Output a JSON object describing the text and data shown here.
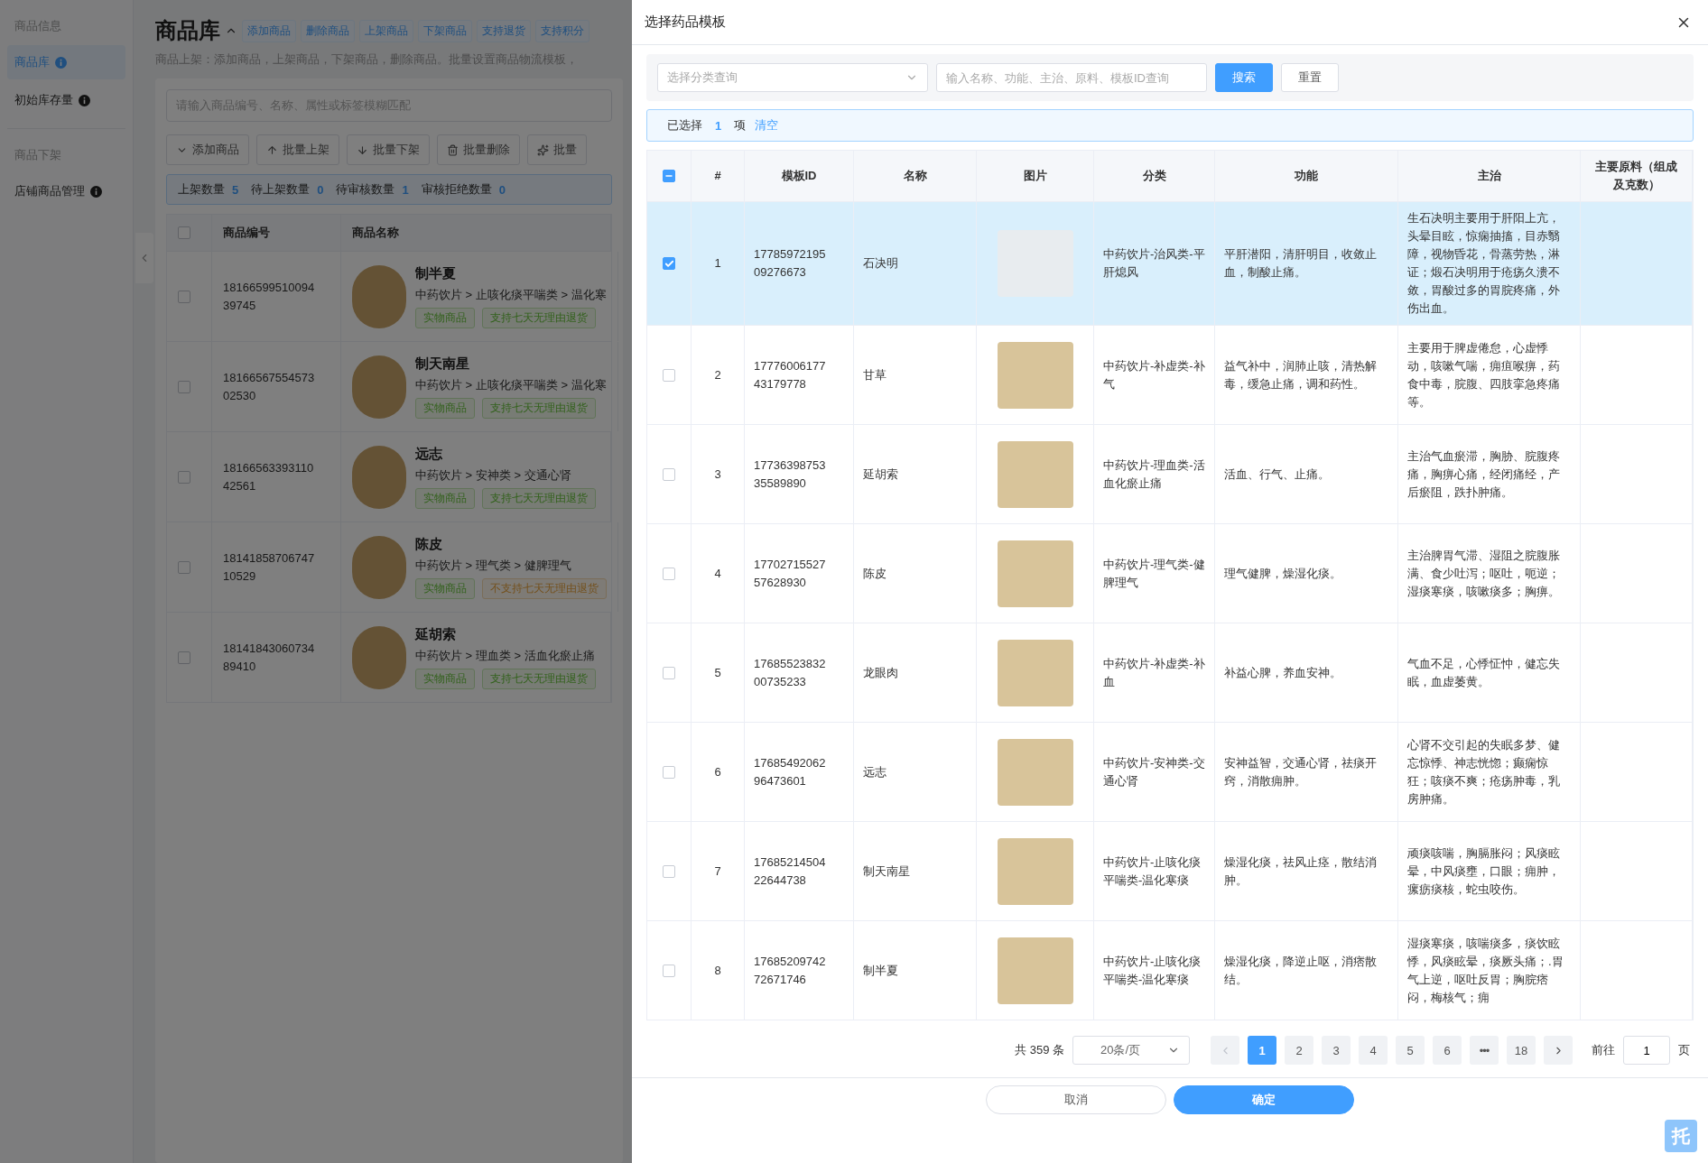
{
  "background_page": {
    "sidebar": [
      {
        "kind": "group",
        "label": "商品信息"
      },
      {
        "kind": "item",
        "label": "商品库",
        "selected": true,
        "info": true
      },
      {
        "kind": "item",
        "label": "初始库存量",
        "selected": false,
        "info": true
      },
      {
        "kind": "divider"
      },
      {
        "kind": "group",
        "label": "商品下架"
      },
      {
        "kind": "item",
        "label": "店铺商品管理",
        "selected": false,
        "info": true
      }
    ],
    "title": "商品库",
    "title_tags": [
      "添加商品",
      "删除商品",
      "上架商品",
      "下架商品",
      "支持退货",
      "支持积分"
    ],
    "subtitle": "商品上架：添加商品，上架商品，下架商品，删除商品。批量设置商品物流模板，",
    "search": {
      "placeholder": "请输入商品编号、名称、属性或标签模糊匹配"
    },
    "toolbar": [
      {
        "kind": "down",
        "label": "添加商品"
      },
      {
        "kind": "up",
        "label": "批量上架"
      },
      {
        "kind": "arrow_down",
        "label": "批量下架"
      },
      {
        "kind": "trash",
        "label": "批量删除"
      },
      {
        "kind": "spark",
        "label": "批量"
      }
    ],
    "stats": [
      {
        "label": "上架数量",
        "value": "5"
      },
      {
        "label": "待上架数量",
        "value": "0"
      },
      {
        "label": "待审核数量",
        "value": "1"
      },
      {
        "label": "审核拒绝数量",
        "value": "0"
      }
    ],
    "table": {
      "header_checked": false,
      "columns": [
        "商品编号",
        "商品名称"
      ],
      "rows": [
        {
          "checked": false,
          "id": "1816659951009439745",
          "name": "制半夏",
          "category": "中药饮片 > 止咳化痰平喘类 > 温化寒",
          "tags": [
            {
              "kind": "success",
              "label": "实物商品"
            },
            {
              "kind": "success",
              "label": "支持七天无理由退货"
            }
          ]
        },
        {
          "checked": false,
          "id": "1816656755457302530",
          "name": "制天南星",
          "category": "中药饮片 > 止咳化痰平喘类 > 温化寒",
          "tags": [
            {
              "kind": "success",
              "label": "实物商品"
            },
            {
              "kind": "success",
              "label": "支持七天无理由退货"
            }
          ]
        },
        {
          "checked": false,
          "id": "1816656339311042561",
          "name": "远志",
          "category": "中药饮片 > 安神类 > 交通心肾",
          "tags": [
            {
              "kind": "success",
              "label": "实物商品"
            },
            {
              "kind": "success",
              "label": "支持七天无理由退货"
            }
          ]
        },
        {
          "checked": false,
          "id": "1814185870674710529",
          "name": "陈皮",
          "category": "中药饮片 > 理气类 > 健脾理气",
          "tags": [
            {
              "kind": "success",
              "label": "实物商品"
            },
            {
              "kind": "warning",
              "label": "不支持七天无理由退货"
            }
          ]
        },
        {
          "checked": false,
          "id": "1814184306073489410",
          "name": "延胡索",
          "category": "中药饮片 > 理血类 > 活血化瘀止痛",
          "tags": [
            {
              "kind": "success",
              "label": "实物商品"
            },
            {
              "kind": "success",
              "label": "支持七天无理由退货"
            }
          ]
        }
      ]
    }
  },
  "dialog": {
    "title": "选择药品模板",
    "category_select": {
      "placeholder": "选择分类查询"
    },
    "search": {
      "placeholder": "输入名称、功能、主治、原料、模板ID查询"
    },
    "search_button": "搜索",
    "reset_button": "重置",
    "selection": {
      "prefix": "已选择",
      "count": "1",
      "suffix": "项",
      "clear": "清空"
    },
    "table": {
      "header_checkbox": {
        "indeterminate": true
      },
      "columns": [
        "#",
        "模板ID",
        "名称",
        "图片",
        "分类",
        "功能",
        "主治",
        "主要原料（组成及克数）"
      ],
      "rows": [
        {
          "selected": true,
          "index": "1",
          "id": "1778597219509276673",
          "name": "石决明",
          "category": "中药饮片-治风类-平肝熄风",
          "function": "平肝潜阳，清肝明目，收敛止血，制酸止痛。",
          "indications": "生石决明主要用于肝阳上亢，头晕目眩，惊痫抽搐，目赤翳障，视物昏花，骨蒸劳热，淋证；煅石决明用于疮疡久溃不敛，胃酸过多的胃脘疼痛，外伤出血。"
        },
        {
          "selected": false,
          "index": "2",
          "id": "1777600617743179778",
          "name": "甘草",
          "category": "中药饮片-补虚类-补气",
          "function": "益气补中，润肺止咳，清热解毒，缓急止痛，调和药性。",
          "indications": "主要用于脾虚倦怠，心虚悸动，咳嗽气喘，痈疽喉痹，药食中毒，脘腹、四肢挛急疼痛等。"
        },
        {
          "selected": false,
          "index": "3",
          "id": "1773639875335589890",
          "name": "延胡索",
          "category": "中药饮片-理血类-活血化瘀止痛",
          "function": "活血、行气、止痛。",
          "indications": "主治气血瘀滞，胸胁、脘腹疼痛，胸痹心痛，经闭痛经，产后瘀阻，跌扑肿痛。"
        },
        {
          "selected": false,
          "index": "4",
          "id": "1770271552757628930",
          "name": "陈皮",
          "category": "中药饮片-理气类-健脾理气",
          "function": "理气健脾，燥湿化痰。",
          "indications": "主治脾胃气滞、湿阻之脘腹胀满、食少吐泻；呕吐，呃逆；湿痰寒痰，咳嗽痰多；胸痹。"
        },
        {
          "selected": false,
          "index": "5",
          "id": "1768552383200735233",
          "name": "龙眼肉",
          "category": "中药饮片-补虚类-补血",
          "function": "补益心脾，养血安神。",
          "indications": "气血不足，心悸怔忡，健忘失眠，血虚萎黄。"
        },
        {
          "selected": false,
          "index": "6",
          "id": "1768549206296473601",
          "name": "远志",
          "category": "中药饮片-安神类-交通心肾",
          "function": "安神益智，交通心肾，祛痰开窍，消散痈肿。",
          "indications": "心肾不交引起的失眠多梦、健忘惊悸、神志恍惚；癫痫惊狂；咳痰不爽；疮疡肿毒，乳房肿痛。"
        },
        {
          "selected": false,
          "index": "7",
          "id": "1768521450422644738",
          "name": "制天南星",
          "category": "中药饮片-止咳化痰平喘类-温化寒痰",
          "function": "燥湿化痰，祛风止痉，散结消肿。",
          "indications": "顽痰咳喘，胸膈胀闷；风痰眩晕，中风痰壅，口眼；痈肿，瘰疬痰核，蛇虫咬伤。"
        },
        {
          "selected": false,
          "index": "8",
          "id": "1768520974272671746",
          "name": "制半夏",
          "category": "中药饮片-止咳化痰平喘类-温化寒痰",
          "function": "燥湿化痰，降逆止呕，消痞散结。",
          "indications": "湿痰寒痰，咳喘痰多，痰饮眩悸，风痰眩晕，痰厥头痛；.胃气上逆，呕吐反胃；胸脘痞闷，梅核气；痈"
        }
      ]
    },
    "pagination": {
      "total": "共 359 条",
      "page_size": "20条/页",
      "prev_disabled": true,
      "pages": [
        {
          "kind": "page",
          "label": "1",
          "selected": true
        },
        {
          "kind": "page",
          "label": "2",
          "selected": false
        },
        {
          "kind": "page",
          "label": "3",
          "selected": false
        },
        {
          "kind": "page",
          "label": "4",
          "selected": false
        },
        {
          "kind": "page",
          "label": "5",
          "selected": false
        },
        {
          "kind": "page",
          "label": "6",
          "selected": false
        },
        {
          "kind": "more",
          "label": "•••",
          "selected": false
        },
        {
          "kind": "page",
          "label": "18",
          "selected": false
        }
      ],
      "goto_label": "前往",
      "goto_value": "1",
      "goto_suffix": "页"
    },
    "cancel_button": "取消",
    "confirm_button": "确定"
  },
  "float_button": "托"
}
